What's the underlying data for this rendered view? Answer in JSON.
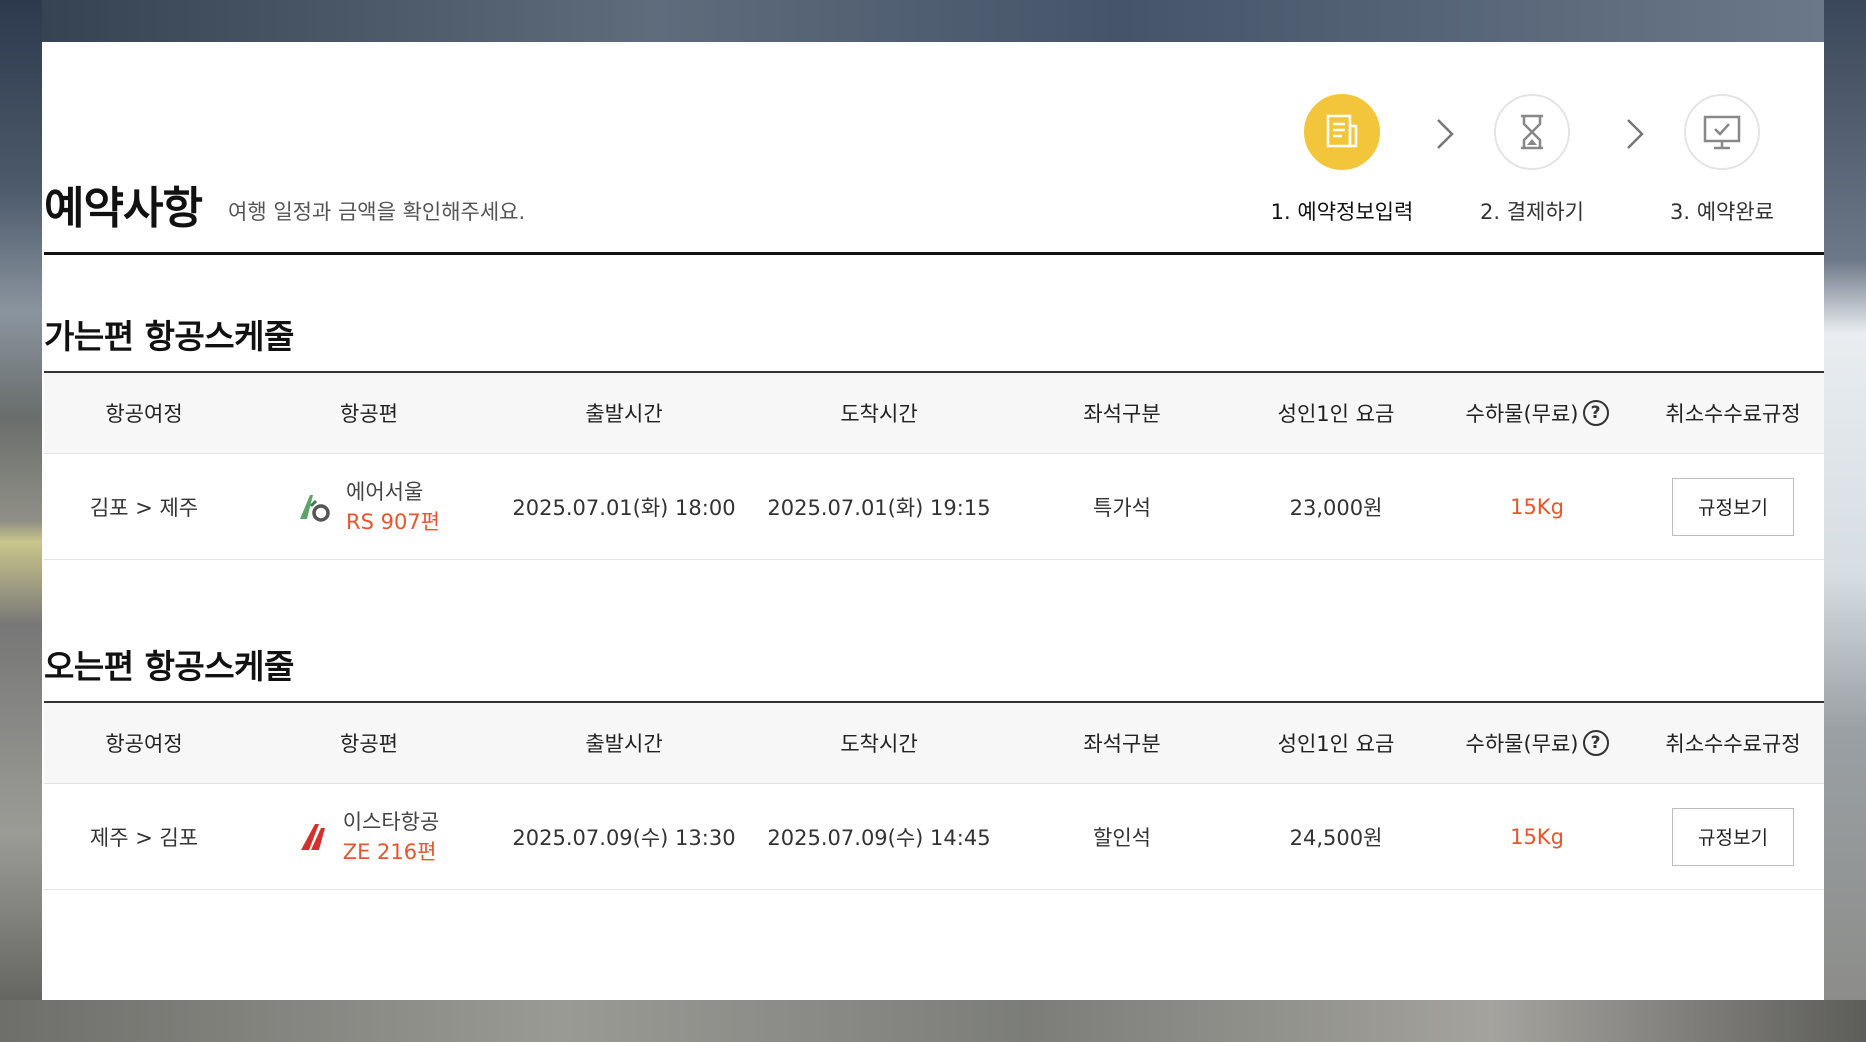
{
  "header": {
    "title": "예약사항",
    "subtitle": "여행 일정과 금액을 확인해주세요."
  },
  "steps": [
    {
      "label": "1. 예약정보입력",
      "icon": "document-icon",
      "active": true
    },
    {
      "label": "2. 결제하기",
      "icon": "hourglass-icon",
      "active": false
    },
    {
      "label": "3. 예약완료",
      "icon": "monitor-check-icon",
      "active": false
    }
  ],
  "columns": [
    "항공여정",
    "항공편",
    "출발시간",
    "도착시간",
    "좌석구분",
    "성인1인 요금",
    "수하물(무료)",
    "취소수수료규정"
  ],
  "help_symbol": "?",
  "outbound": {
    "title": "가는편 항공스케줄",
    "route": "김포 > 제주",
    "airline": "에어서울",
    "flight": "RS 907편",
    "departure": "2025.07.01(화) 18:00",
    "arrival": "2025.07.01(화) 19:15",
    "seat_class": "특가석",
    "adult_fare": "23,000원",
    "baggage": "15Kg",
    "rule_button": "규정보기"
  },
  "inbound": {
    "title": "오는편 항공스케줄",
    "route": "제주 > 김포",
    "airline": "이스타항공",
    "flight": "ZE 216편",
    "departure": "2025.07.09(수) 13:30",
    "arrival": "2025.07.09(수) 14:45",
    "seat_class": "할인석",
    "adult_fare": "24,500원",
    "baggage": "15Kg",
    "rule_button": "규정보기"
  },
  "colors": {
    "accent_yellow": "#f3c53a",
    "highlight_orange": "#e4572e",
    "airseoul_green": "#5aa469",
    "eastar_red": "#d3322c"
  }
}
